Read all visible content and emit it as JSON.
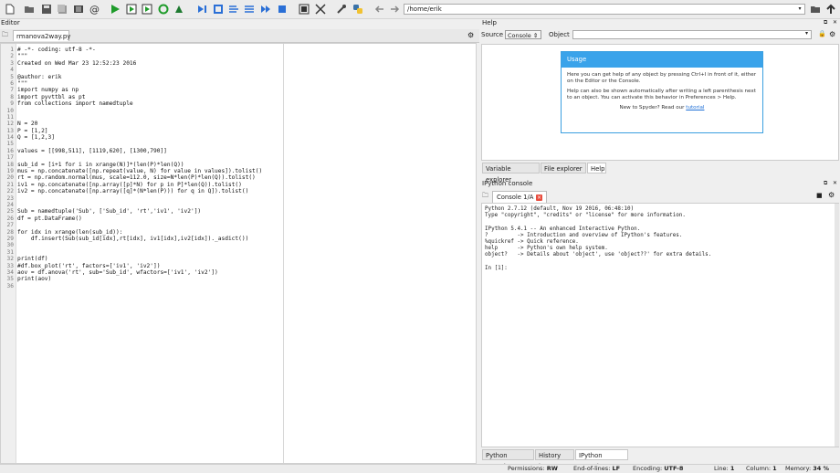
{
  "toolbar": {
    "path": "/home/erik",
    "icons": [
      "new-file-icon",
      "open-folder-icon",
      "save-icon",
      "save-all-icon",
      "list-icon",
      "at-icon",
      "run-icon",
      "run-file-icon",
      "run-cell-icon",
      "run-cell-advance-icon",
      "rerun-icon",
      "debug-icon",
      "step-icon",
      "step-into-icon",
      "step-return-icon",
      "continue-icon",
      "stop-icon",
      "maximize-icon",
      "fullscreen-icon",
      "wrench-icon",
      "python-icon",
      "back-icon",
      "forward-icon",
      "browse-folder-icon",
      "up-arrow-icon"
    ]
  },
  "editor": {
    "title": "Editor",
    "tab_label": "rmanova2way.py",
    "lines": [
      "# -*- coding: utf-8 -*-",
      "\"\"\"",
      "Created on Wed Mar 23 12:52:23 2016",
      "",
      "@author: erik",
      "\"\"\"",
      "import numpy as np",
      "import pyvttbl as pt",
      "from collections import namedtuple",
      "",
      "",
      "N = 20",
      "P = [1,2]",
      "Q = [1,2,3]",
      "",
      "values = [[998,511], [1119,620], [1300,790]]",
      "",
      "sub_id = [i+1 for i in xrange(N)]*(len(P)*len(Q))",
      "mus = np.concatenate([np.repeat(value, N) for value in values]).tolist()",
      "rt = np.random.normal(mus, scale=112.0, size=N*len(P)*len(Q)).tolist()",
      "iv1 = np.concatenate([np.array([p]*N) for p in P]*len(Q)).tolist()",
      "iv2 = np.concatenate([np.array([q]*(N*len(P))) for q in Q]).tolist()",
      "",
      "",
      "Sub = namedtuple('Sub', ['Sub_id', 'rt','iv1', 'iv2'])",
      "df = pt.DataFrame()",
      "",
      "for idx in xrange(len(sub_id)):",
      "    df.insert(Sub(sub_id[idx],rt[idx], iv1[idx],iv2[idx])._asdict())",
      "",
      "",
      "print(df)",
      "#df.box_plot('rt', factors=['iv1', 'iv2'])",
      "aov = df.anova('rt', sub='Sub_id', wfactors=['iv1', 'iv2'])",
      "print(aov)",
      ""
    ]
  },
  "help": {
    "title": "Help",
    "source_label": "Source",
    "source_value": "Console",
    "object_label": "Object",
    "object_value": "",
    "usage_title": "Usage",
    "usage_p1": "Here you can get help of any object by pressing Ctrl+I in front of it, either on the Editor or the Console.",
    "usage_p2": "Help can also be shown automatically after writing a left parenthesis next to an object. You can activate this behavior in Preferences > Help.",
    "usage_p3_prefix": "New to Spyder? Read our ",
    "usage_p3_link": "tutorial",
    "tabs": [
      "Variable explorer",
      "File explorer",
      "Help"
    ]
  },
  "ipython": {
    "title": "IPython console",
    "tab_label": "Console 1/A",
    "output": [
      "Python 2.7.12 (default, Nov 19 2016, 06:48:10)",
      "Type \"copyright\", \"credits\" or \"license\" for more information.",
      "",
      "IPython 5.4.1 -- An enhanced Interactive Python.",
      "?         -> Introduction and overview of IPython's features.",
      "%quickref -> Quick reference.",
      "help      -> Python's own help system.",
      "object?   -> Details about 'object', use 'object??' for extra details.",
      "",
      "In [1]:"
    ],
    "tabs": [
      "Python console",
      "History log",
      "IPython console"
    ]
  },
  "status": {
    "permissions_label": "Permissions:",
    "permissions_value": "RW",
    "eol_label": "End-of-lines:",
    "eol_value": "LF",
    "encoding_label": "Encoding:",
    "encoding_value": "UTF-8",
    "line_label": "Line:",
    "line_value": "1",
    "column_label": "Column:",
    "column_value": "1",
    "memory_label": "Memory:",
    "memory_value": "34 %"
  }
}
